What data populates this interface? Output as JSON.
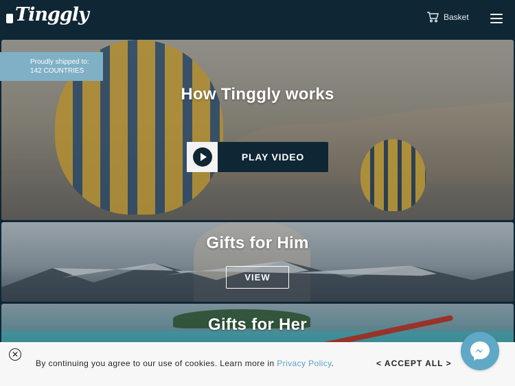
{
  "header": {
    "logo_text": "Tinggly",
    "basket_label": "Basket",
    "icons": {
      "basket": "shopping-cart-icon",
      "menu": "hamburger-menu-icon"
    }
  },
  "hero": {
    "shipped_line1": "Proudly shipped to:",
    "shipped_line2": "142 COUNTRIES",
    "title": "How Tinggly works",
    "play_label": "PLAY VIDEO",
    "icons": {
      "play": "play-icon"
    }
  },
  "gifts_him": {
    "title": "Gifts for Him",
    "button_label": "VIEW"
  },
  "gifts_her": {
    "title": "Gifts for Her"
  },
  "cookie_bar": {
    "text": "By continuing you agree to our use of cookies. Learn more in ",
    "link_text": "Privacy Policy",
    "suffix": ".",
    "accept_label": "< ACCEPT ALL >",
    "icons": {
      "close": "close-circle-icon"
    }
  },
  "messenger": {
    "icon": "messenger-icon"
  },
  "colors": {
    "header_bg": "#0f2634",
    "shipped_bg": "#7fb0c6",
    "link": "#5a9fc0",
    "messenger": "#5fa8c6"
  }
}
